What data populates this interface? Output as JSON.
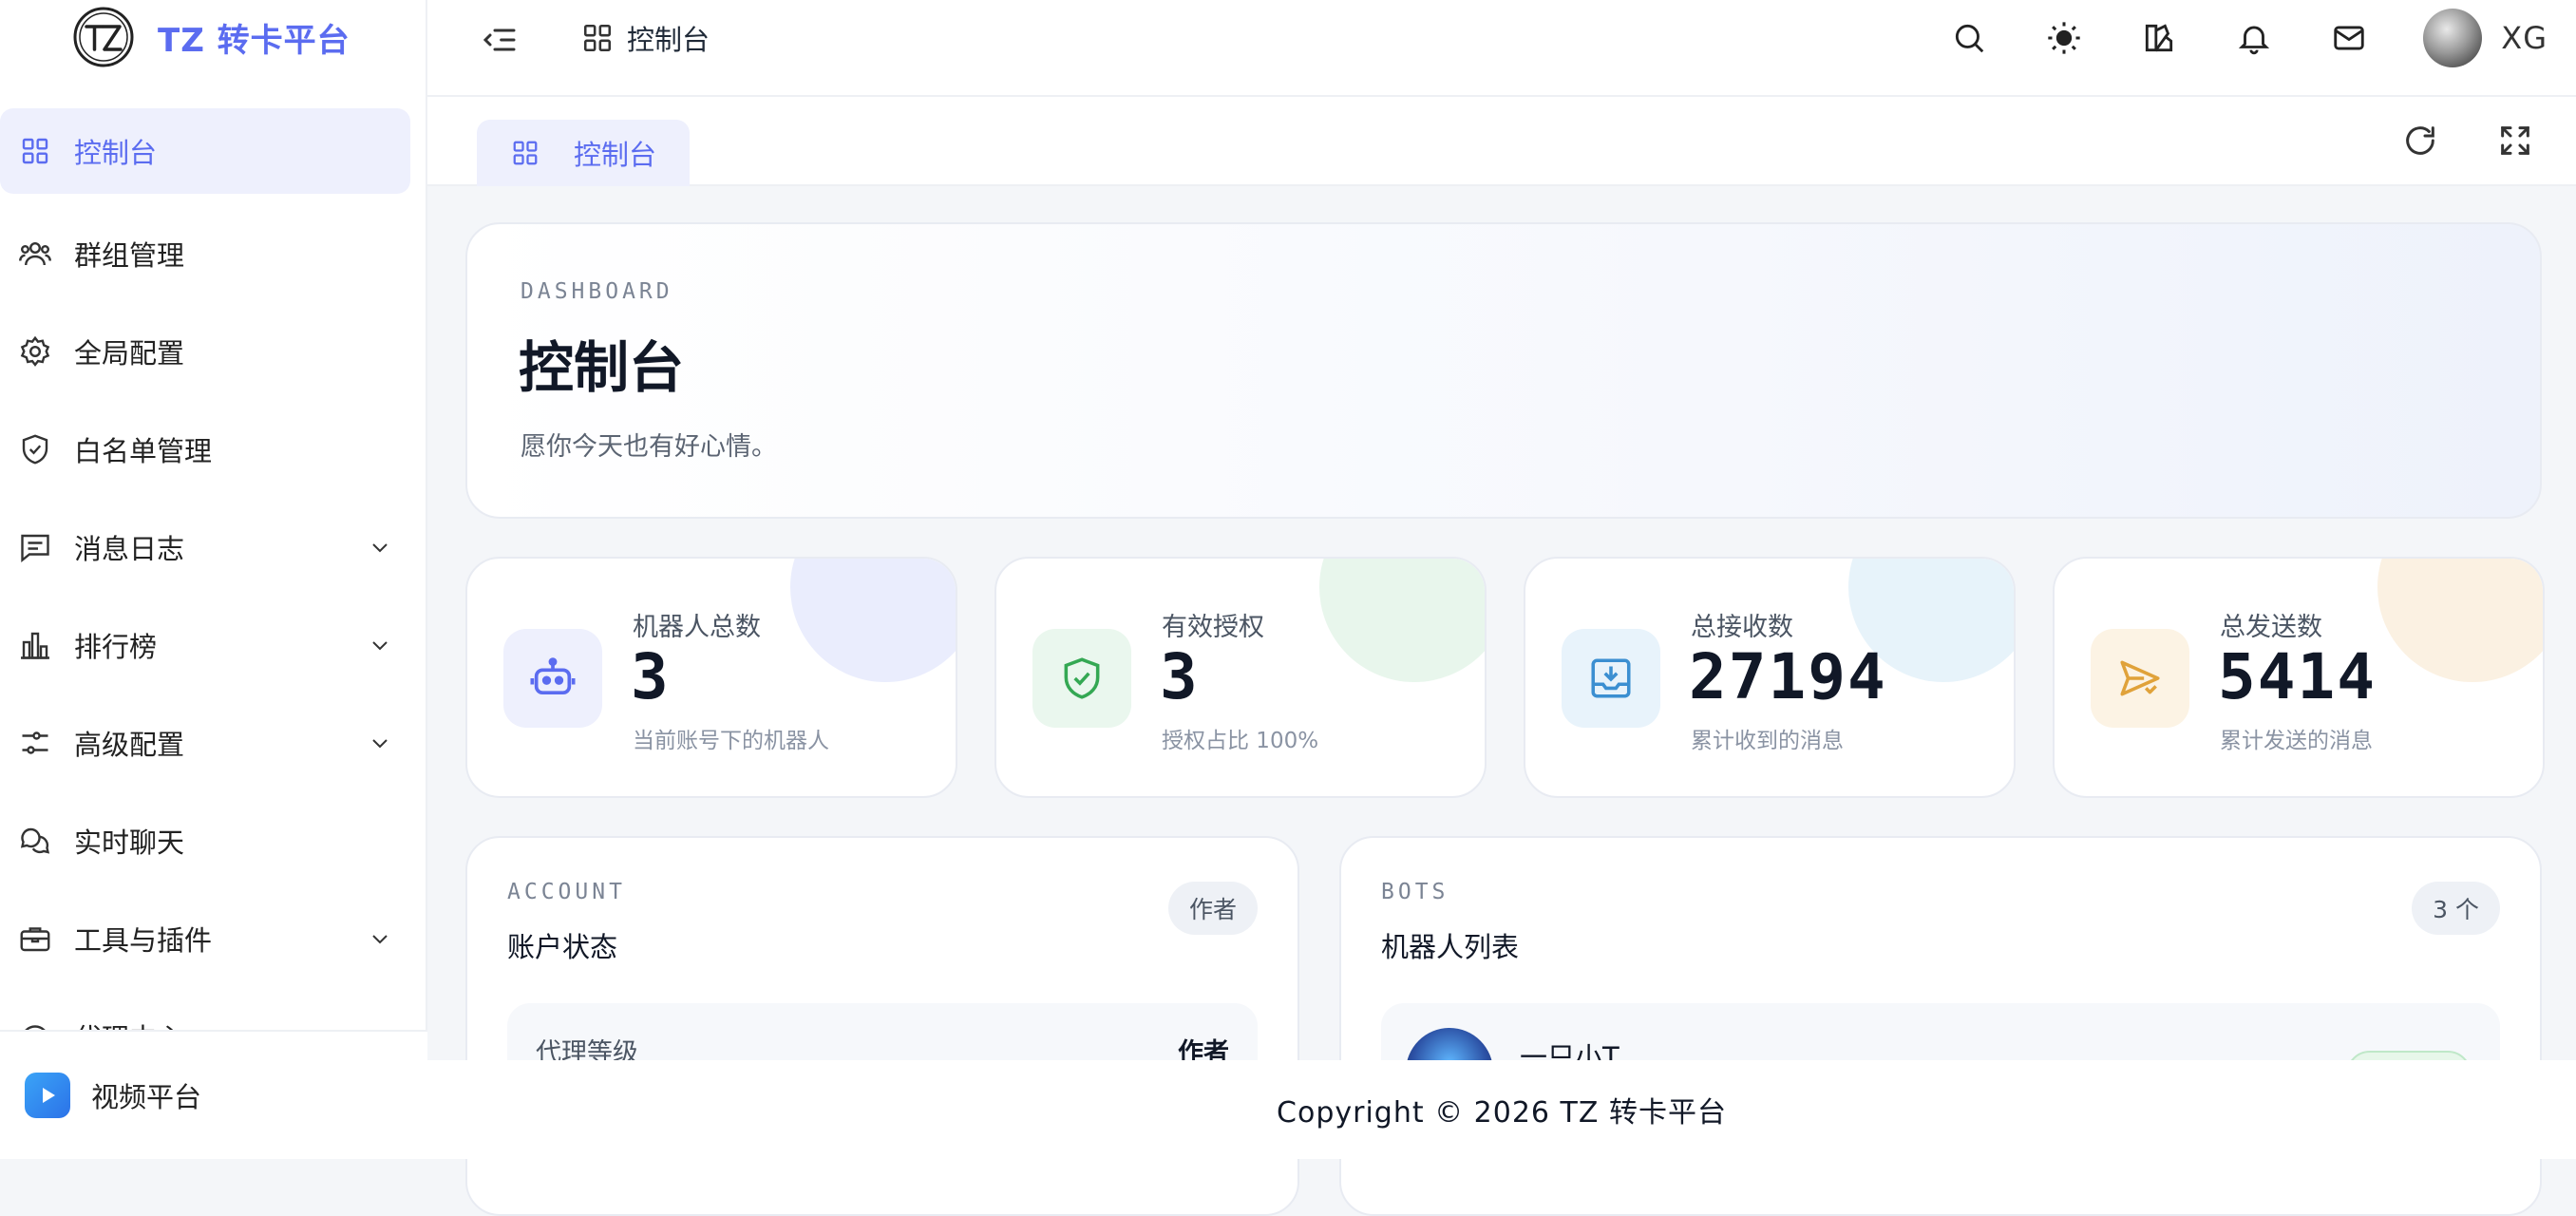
{
  "app": {
    "brand_name": "TZ 转卡平台",
    "brand_color": "#5b6cf0"
  },
  "sidebar": {
    "items": [
      {
        "label": "控制台",
        "icon": "grid-icon",
        "active": true
      },
      {
        "label": "群组管理",
        "icon": "users-icon"
      },
      {
        "label": "全局配置",
        "icon": "gear-icon"
      },
      {
        "label": "白名单管理",
        "icon": "shield-check-icon"
      },
      {
        "label": "消息日志",
        "icon": "message-square-icon",
        "expandable": true
      },
      {
        "label": "排行榜",
        "icon": "bar-chart-icon",
        "expandable": true
      },
      {
        "label": "高级配置",
        "icon": "sliders-icon",
        "expandable": true
      },
      {
        "label": "实时聊天",
        "icon": "chat-bubbles-icon"
      },
      {
        "label": "工具与插件",
        "icon": "briefcase-icon",
        "expandable": true
      },
      {
        "label": "代理中心",
        "icon": "agent-icon"
      }
    ],
    "bottom_link": {
      "label": "视频平台",
      "icon": "video-play-icon"
    }
  },
  "header": {
    "breadcrumb": "控制台",
    "username": "XG",
    "icons": [
      "search-icon",
      "sun-icon",
      "theme-icon",
      "bell-icon",
      "mail-icon"
    ]
  },
  "tabs": [
    {
      "label": "控制台",
      "icon": "grid-icon",
      "active": true
    }
  ],
  "hero": {
    "kicker": "DASHBOARD",
    "title": "控制台",
    "subtitle": "愿你今天也有好心情。"
  },
  "stats": [
    {
      "label": "机器人总数",
      "value": "3",
      "note": "当前账号下的机器人",
      "icon": "robot-icon",
      "color": "#5b6cf0"
    },
    {
      "label": "有效授权",
      "value": "3",
      "note": "授权占比 100%",
      "icon": "shield-check-icon",
      "color": "#34a853"
    },
    {
      "label": "总接收数",
      "value": "27194",
      "note": "累计收到的消息",
      "icon": "inbox-download-icon",
      "color": "#3b8fd1"
    },
    {
      "label": "总发送数",
      "value": "5414",
      "note": "累计发送的消息",
      "icon": "send-icon",
      "color": "#e0a23a"
    }
  ],
  "account_panel": {
    "kicker": "ACCOUNT",
    "title": "账户状态",
    "badge": "作者",
    "row_label": "代理等级",
    "row_value": "作者"
  },
  "bots_panel": {
    "kicker": "BOTS",
    "title": "机器人列表",
    "badge": "3 个",
    "first_bot_name": "一只小T"
  },
  "footer": {
    "copyright": "Copyright © 2026 TZ 转卡平台"
  }
}
